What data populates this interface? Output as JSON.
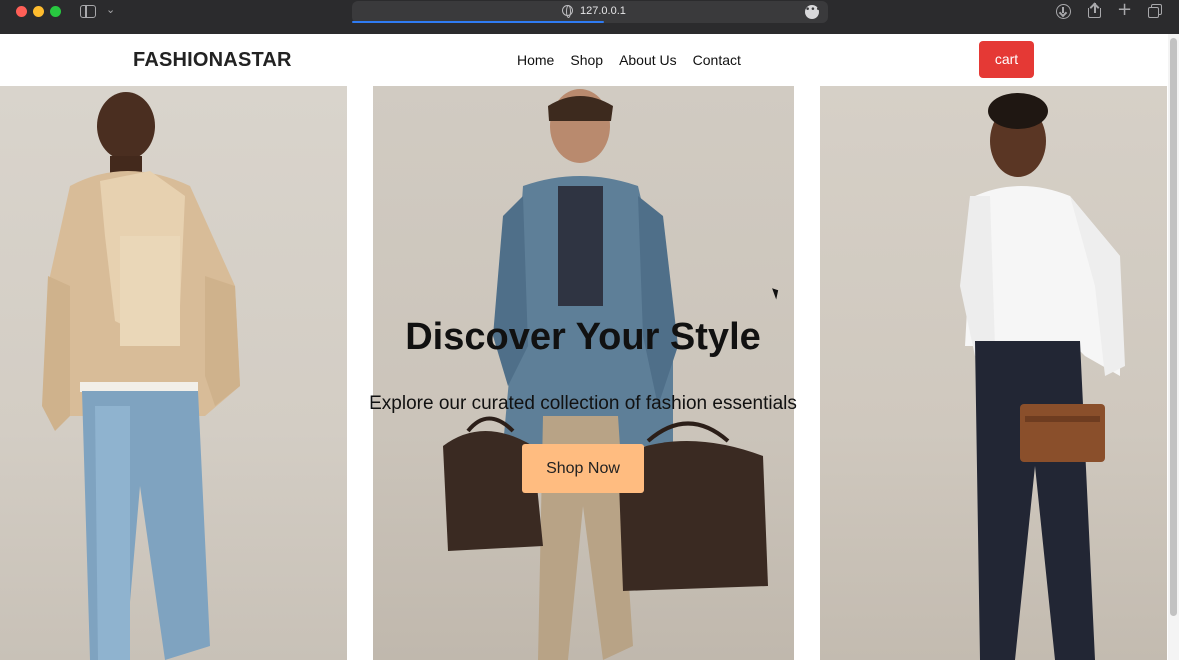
{
  "browser": {
    "url": "127.0.0.1",
    "load_progress": 0.53
  },
  "site": {
    "brand": "FASHIONASTAR",
    "nav": [
      "Home",
      "Shop",
      "About Us",
      "Contact"
    ],
    "cart_label": "cart"
  },
  "hero": {
    "title": "Discover Your Style",
    "subtitle": "Explore our curated collection of fashion essentials",
    "cta_label": "Shop Now"
  },
  "colors": {
    "cart_button": "#e53935",
    "cta_button": "#ffbc80",
    "chrome": "#2b2b2d"
  }
}
